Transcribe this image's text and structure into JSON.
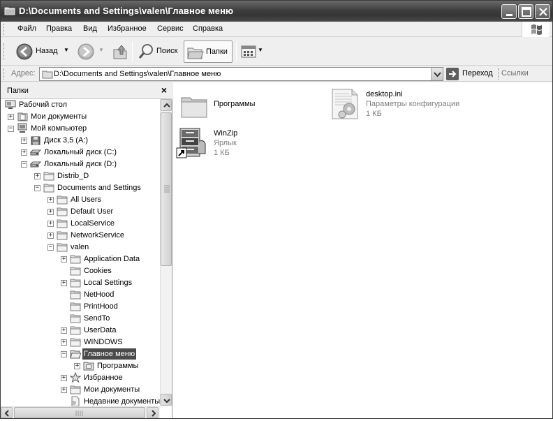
{
  "window": {
    "title": "D:\\Documents and Settings\\valen\\Главное меню"
  },
  "menu": {
    "items": [
      "Файл",
      "Правка",
      "Вид",
      "Избранное",
      "Сервис",
      "Справка"
    ]
  },
  "toolbar": {
    "back_label": "Назад",
    "search_label": "Поиск",
    "folders_label": "Папки"
  },
  "address": {
    "label": "Адрес:",
    "value": "D:\\Documents and Settings\\valen\\Главное меню",
    "go_label": "Переход",
    "links_label": "Ссылки"
  },
  "folders": {
    "title": "Папки",
    "close": "×",
    "tree": [
      {
        "label": "Рабочий стол",
        "icon": "desktop-icon",
        "expander": ""
      },
      {
        "label": "Мои документы",
        "icon": "documents-icon",
        "expander": "+"
      },
      {
        "label": "Мой компьютер",
        "icon": "computer-icon",
        "expander": "−"
      },
      {
        "label": "Диск 3,5 (A:)",
        "icon": "floppy-icon",
        "expander": "+"
      },
      {
        "label": "Локальный диск (C:)",
        "icon": "drive-icon",
        "expander": "+"
      },
      {
        "label": "Локальный диск (D:)",
        "icon": "drive-icon",
        "expander": "−"
      },
      {
        "label": "Distrib_D",
        "icon": "folder-icon",
        "expander": "+"
      },
      {
        "label": "Documents and Settings",
        "icon": "folder-icon",
        "expander": "−"
      },
      {
        "label": "All Users",
        "icon": "folder-icon",
        "expander": "+"
      },
      {
        "label": "Default User",
        "icon": "folder-icon",
        "expander": "+"
      },
      {
        "label": "LocalService",
        "icon": "folder-icon",
        "expander": "+"
      },
      {
        "label": "NetworkService",
        "icon": "folder-icon",
        "expander": "+"
      },
      {
        "label": "valen",
        "icon": "folder-icon",
        "expander": "−"
      },
      {
        "label": "Application Data",
        "icon": "folder-icon",
        "expander": "+"
      },
      {
        "label": "Cookies",
        "icon": "folder-icon",
        "expander": ""
      },
      {
        "label": "Local Settings",
        "icon": "folder-icon",
        "expander": "+"
      },
      {
        "label": "NetHood",
        "icon": "folder-icon",
        "expander": ""
      },
      {
        "label": "PrintHood",
        "icon": "folder-icon",
        "expander": ""
      },
      {
        "label": "SendTo",
        "icon": "folder-icon",
        "expander": ""
      },
      {
        "label": "UserData",
        "icon": "folder-icon",
        "expander": "+"
      },
      {
        "label": "WINDOWS",
        "icon": "folder-icon",
        "expander": "+"
      },
      {
        "label": "Главное меню",
        "icon": "open-folder-icon",
        "expander": "−",
        "selected": true
      },
      {
        "label": "Программы",
        "icon": "programs-folder-icon",
        "expander": "+"
      },
      {
        "label": "Избранное",
        "icon": "favorites-star-icon",
        "expander": "+"
      },
      {
        "label": "Мои документы",
        "icon": "folder-icon",
        "expander": "+"
      },
      {
        "label": "Недавние документы",
        "icon": "recent-docs-icon",
        "expander": ""
      }
    ]
  },
  "content": {
    "items": [
      {
        "name": "Программы",
        "type": "",
        "size": "",
        "icon": "folder-icon"
      },
      {
        "name": "desktop.ini",
        "type": "Параметры конфигурации",
        "size": "1 КБ",
        "icon": "config-file-icon"
      },
      {
        "name": "WinZip",
        "type": "Ярлык",
        "size": "1 КБ",
        "icon": "winzip-shortcut-icon"
      }
    ]
  }
}
